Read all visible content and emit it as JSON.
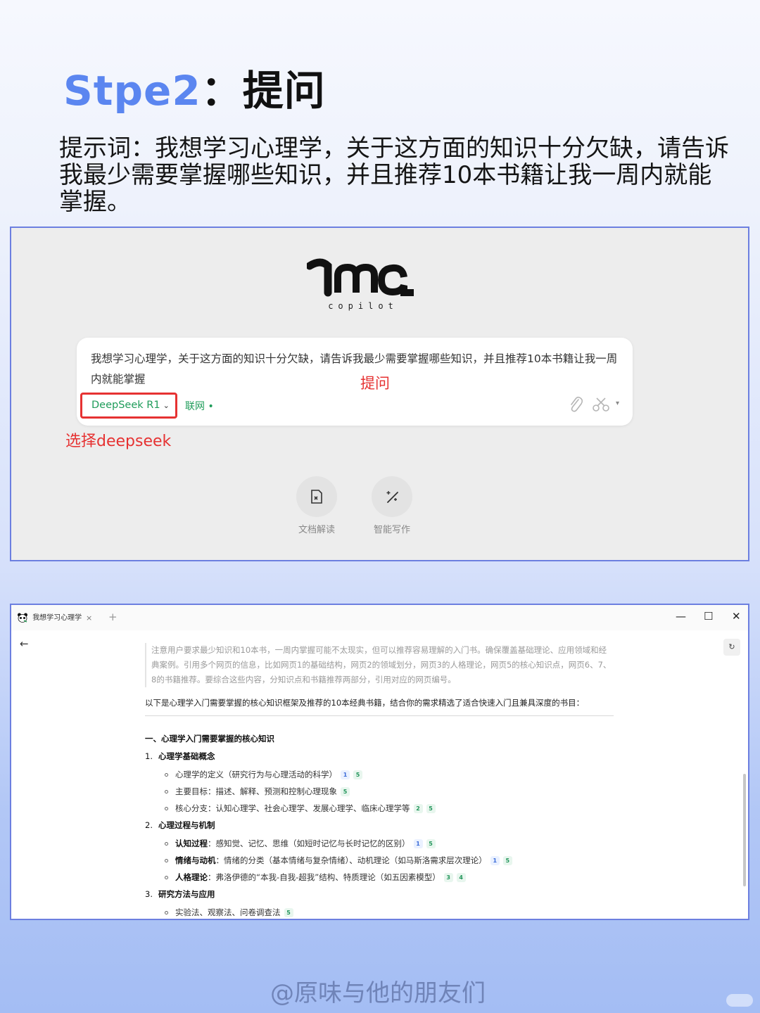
{
  "heading": {
    "en": "Stpe2",
    "sep": "：",
    "cn": "提问"
  },
  "prompt_text": "提示词：我想学习心理学，关于这方面的知识十分欠缺，请告诉我最少需要掌握哪些知识，并且推荐10本书籍让我一周内就能掌握。",
  "ima": {
    "logo_sub": "copilot",
    "input_text": "我想学习心理学，关于这方面的知识十分欠缺，请告诉我最少需要掌握哪些知识，并且推荐10本书籍让我一周内就能掌握",
    "model_label": "DeepSeek R1",
    "chevron": "⌄",
    "web_label": "联网 •",
    "caret": "▾",
    "annot_ask": "提问",
    "annot_deepseek": "选择deepseek",
    "quick": [
      {
        "label": "文档解读",
        "icon": "doc-read-icon"
      },
      {
        "label": "智能写作",
        "icon": "magic-wand-icon"
      }
    ]
  },
  "chat": {
    "tab_title": "我想学习心理学",
    "tab_close": "×",
    "tab_add": "+",
    "win_min": "—",
    "win_max": "☐",
    "win_close": "✕",
    "back": "←",
    "refresh": "↻",
    "thinking": "注意用户要求最少知识和10本书，一周内掌握可能不太现实，但可以推荐容易理解的入门书。确保覆盖基础理论、应用领域和经典案例。引用多个网页的信息，比如网页1的基础结构，网页2的领域划分，网页3的人格理论，网页5的核心知识点，网页6、7、8的书籍推荐。要综合这些内容，分知识点和书籍推荐两部分，引用对应的网页编号。",
    "intro": "以下是心理学入门需要掌握的核心知识框架及推荐的10本经典书籍，结合你的需求精选了适合快速入门且兼具深度的书目：",
    "section_title": "一、心理学入门需要掌握的核心知识",
    "groups": [
      {
        "num": "1.",
        "title": "心理学基础概念",
        "items": [
          {
            "bold": "",
            "text": "心理学的定义（研究行为与心理活动的科学）",
            "cites": [
              "1",
              "5"
            ]
          },
          {
            "bold": "",
            "text": "主要目标：描述、解释、预测和控制心理现象",
            "cites": [
              "5"
            ]
          },
          {
            "bold": "",
            "text": "核心分支：认知心理学、社会心理学、发展心理学、临床心理学等",
            "cites": [
              "2",
              "5"
            ]
          }
        ]
      },
      {
        "num": "2.",
        "title": "心理过程与机制",
        "items": [
          {
            "bold": "认知过程",
            "text": "：感知觉、记忆、思维（如短时记忆与长时记忆的区别）",
            "cites": [
              "1",
              "5"
            ]
          },
          {
            "bold": "情绪与动机",
            "text": "：情绪的分类（基本情绪与复杂情绪）、动机理论（如马斯洛需求层次理论）",
            "cites": [
              "1",
              "5"
            ]
          },
          {
            "bold": "人格理论",
            "text": "：弗洛伊德的“本我-自我-超我”结构、特质理论（如五因素模型）",
            "cites": [
              "3",
              "4"
            ]
          }
        ]
      },
      {
        "num": "3.",
        "title": "研究方法与应用",
        "items": [
          {
            "bold": "",
            "text": "实验法、观察法、问卷调查法",
            "cites": [
              "5"
            ]
          }
        ]
      }
    ]
  },
  "watermark": "@原味与他的朋友们",
  "colors": {
    "accent": "#5b86f0",
    "annotation": "#e63232",
    "model_green": "#1f9c5a",
    "frame": "#6c7fe0"
  }
}
